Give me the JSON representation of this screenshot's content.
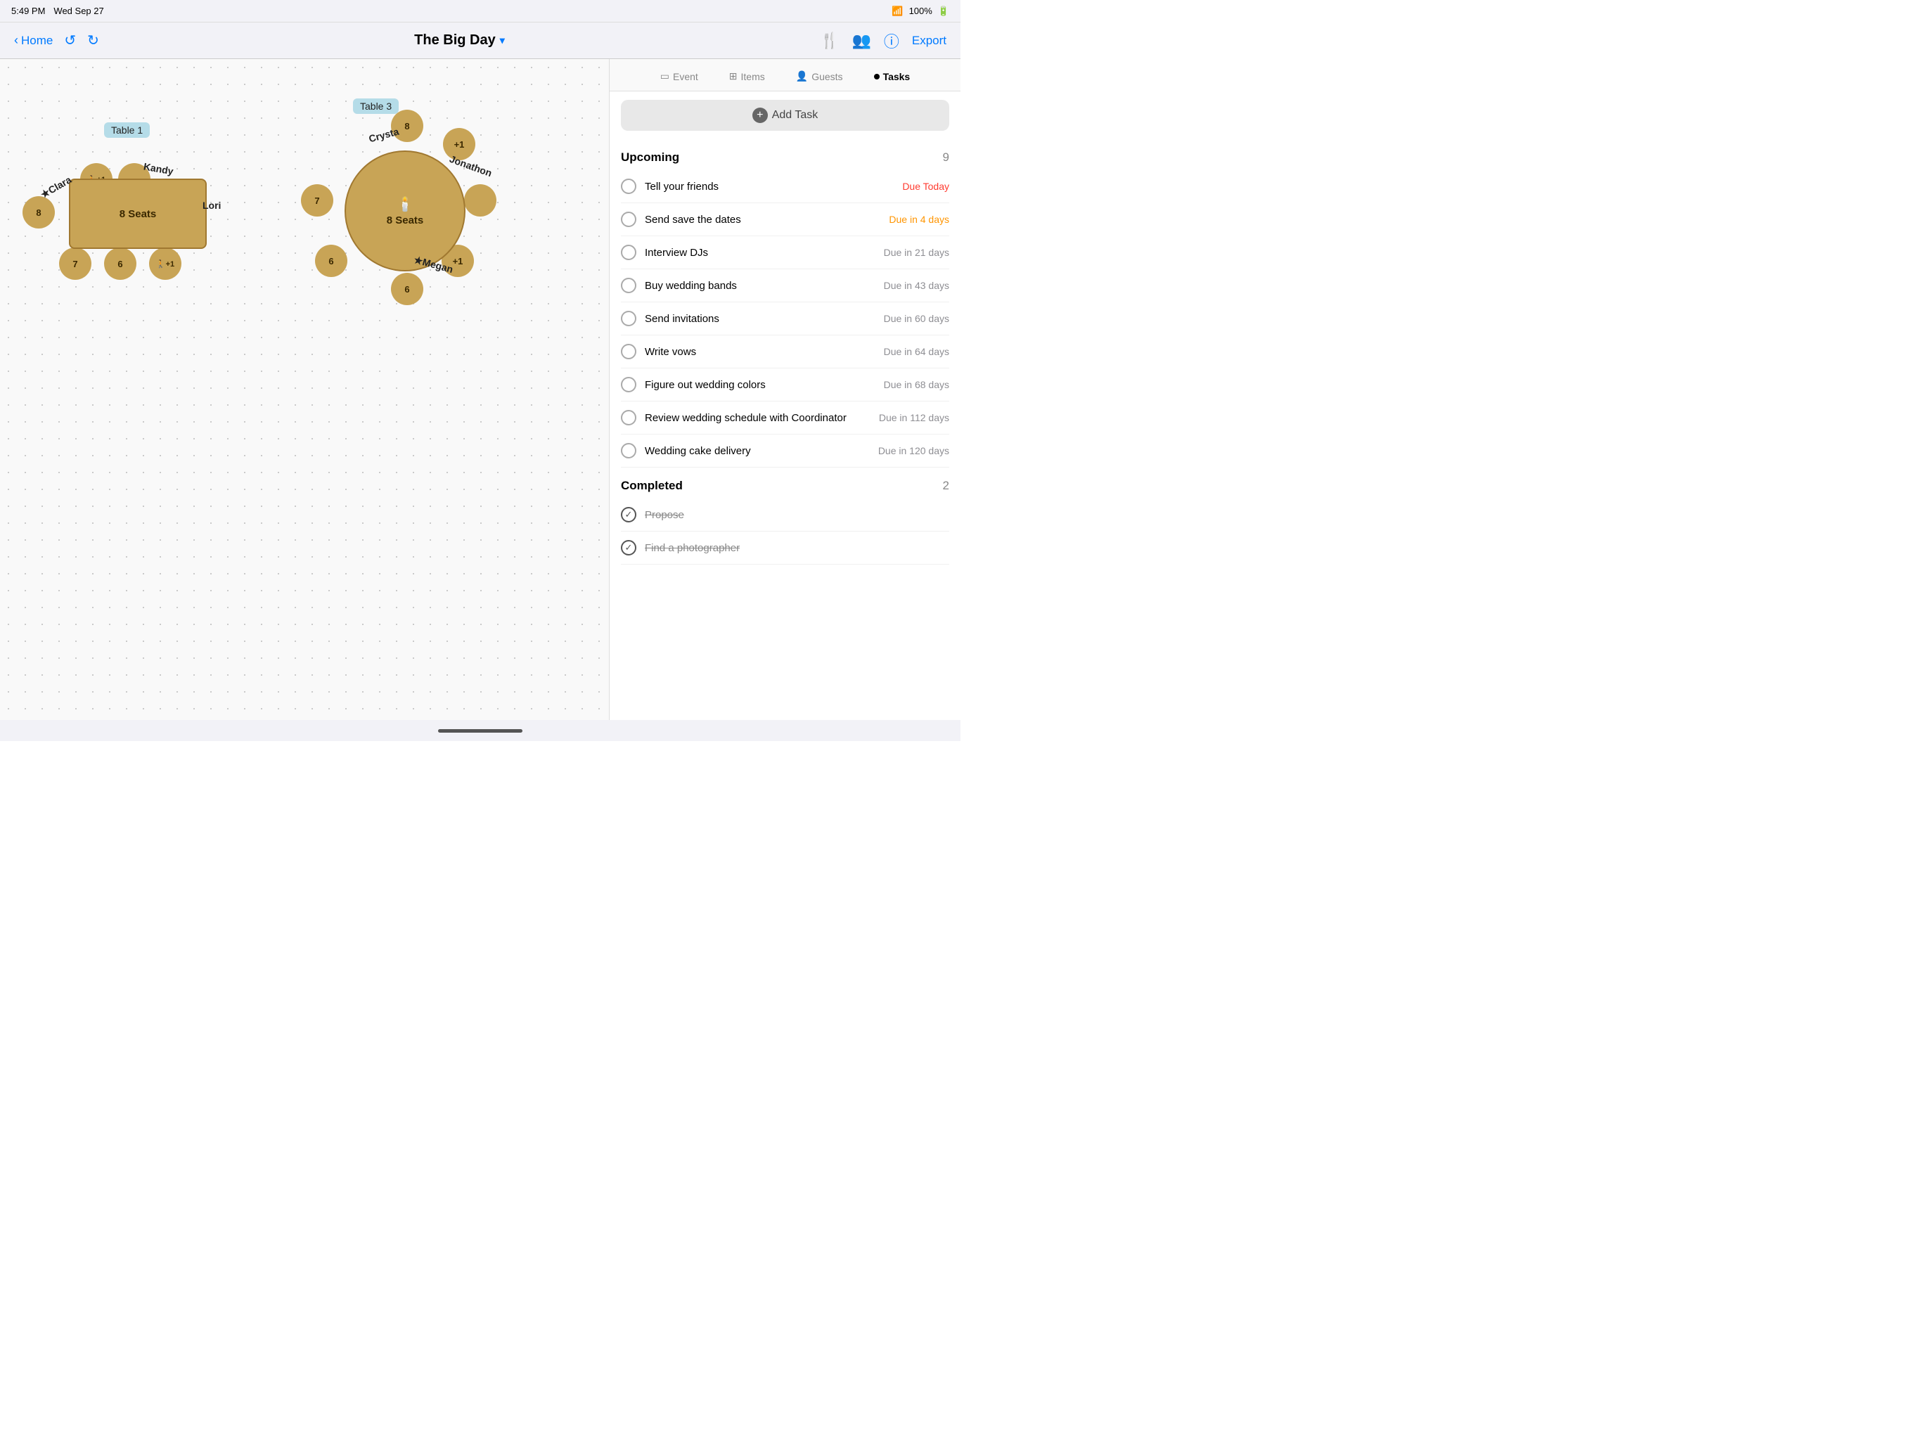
{
  "statusBar": {
    "time": "5:49 PM",
    "date": "Wed Sep 27",
    "battery": "100%",
    "wifi": "WiFi"
  },
  "navBar": {
    "homeLabel": "Home",
    "title": "The Big Day",
    "exportLabel": "Export"
  },
  "tabs": [
    {
      "id": "event",
      "label": "Event",
      "icon": "rectangle-icon",
      "active": false
    },
    {
      "id": "items",
      "label": "Items",
      "icon": "grid-icon",
      "active": false
    },
    {
      "id": "guests",
      "label": "Guests",
      "icon": "person-icon",
      "active": false
    },
    {
      "id": "tasks",
      "label": "Tasks",
      "icon": "dot-icon",
      "active": true
    }
  ],
  "addTaskLabel": "Add Task",
  "sections": [
    {
      "id": "upcoming",
      "title": "Upcoming",
      "count": "9",
      "tasks": [
        {
          "id": 1,
          "text": "Tell your friends",
          "due": "Due Today",
          "dueClass": "due-today",
          "completed": false
        },
        {
          "id": 2,
          "text": "Send save the dates",
          "due": "Due in 4 days",
          "dueClass": "due-soon",
          "completed": false
        },
        {
          "id": 3,
          "text": "Interview DJs",
          "due": "Due in 21 days",
          "dueClass": "due-normal",
          "completed": false
        },
        {
          "id": 4,
          "text": "Buy wedding bands",
          "due": "Due in 43 days",
          "dueClass": "due-normal",
          "completed": false
        },
        {
          "id": 5,
          "text": "Send invitations",
          "due": "Due in 60 days",
          "dueClass": "due-normal",
          "completed": false
        },
        {
          "id": 6,
          "text": "Write vows",
          "due": "Due in 64 days",
          "dueClass": "due-normal",
          "completed": false
        },
        {
          "id": 7,
          "text": "Figure out wedding colors",
          "due": "Due in 68 days",
          "dueClass": "due-normal",
          "completed": false
        },
        {
          "id": 8,
          "text": "Review wedding schedule with Coordinator",
          "due": "Due in 112 days",
          "dueClass": "due-normal",
          "completed": false
        },
        {
          "id": 9,
          "text": "Wedding cake delivery",
          "due": "Due in 120 days",
          "dueClass": "due-normal",
          "completed": false
        }
      ]
    },
    {
      "id": "completed",
      "title": "Completed",
      "count": "2",
      "tasks": [
        {
          "id": 10,
          "text": "Propose",
          "due": "",
          "dueClass": "",
          "completed": true
        },
        {
          "id": 11,
          "text": "Find a photographer",
          "due": "",
          "dueClass": "",
          "completed": true
        }
      ]
    }
  ],
  "tables": [
    {
      "id": "table1",
      "label": "Table 1",
      "type": "rect",
      "seats": "8 Seats",
      "guests": [
        "Clara",
        "Kandy",
        "Lori",
        "🚶+1",
        "+1"
      ],
      "seatNumbers": [
        8,
        7,
        6
      ]
    },
    {
      "id": "table3",
      "label": "Table 3",
      "type": "circle",
      "seats": "8 Seats",
      "guests": [
        "Crysta",
        "+1",
        "Jonathon",
        "Megan",
        "+1"
      ],
      "seatNumbers": [
        8,
        7,
        6,
        6
      ]
    }
  ]
}
